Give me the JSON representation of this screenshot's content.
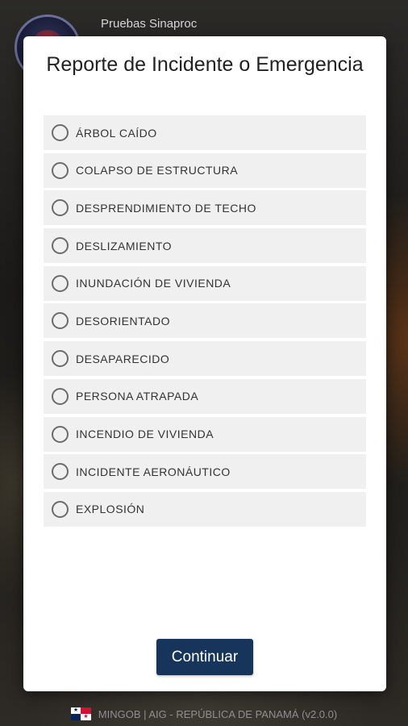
{
  "app": {
    "title": "Pruebas Sinaproc"
  },
  "dialog": {
    "title": "Reporte de Incidente o Emergencia",
    "options": [
      "ÁRBOL CAÍDO",
      "COLAPSO DE ESTRUCTURA",
      "DESPRENDIMIENTO DE TECHO",
      "DESLIZAMIENTO",
      "INUNDACIÓN DE VIVIENDA",
      "DESORIENTADO",
      "DESAPARECIDO",
      "PERSONA ATRAPADA",
      "INCENDIO DE VIVIENDA",
      "INCIDENTE AERONÁUTICO",
      "EXPLOSIÓN"
    ],
    "continue_label": "Continuar"
  },
  "footer": {
    "text": "MINGOB | AIG - REPÚBLICA DE PANAMÁ (v2.0.0)"
  },
  "colors": {
    "button_bg": "#17355a",
    "option_bg": "#f0f0f0"
  },
  "icons": {
    "logo": "sinaproc-logo",
    "flag": "panama-flag-icon",
    "radio": "radio-unchecked-icon"
  }
}
